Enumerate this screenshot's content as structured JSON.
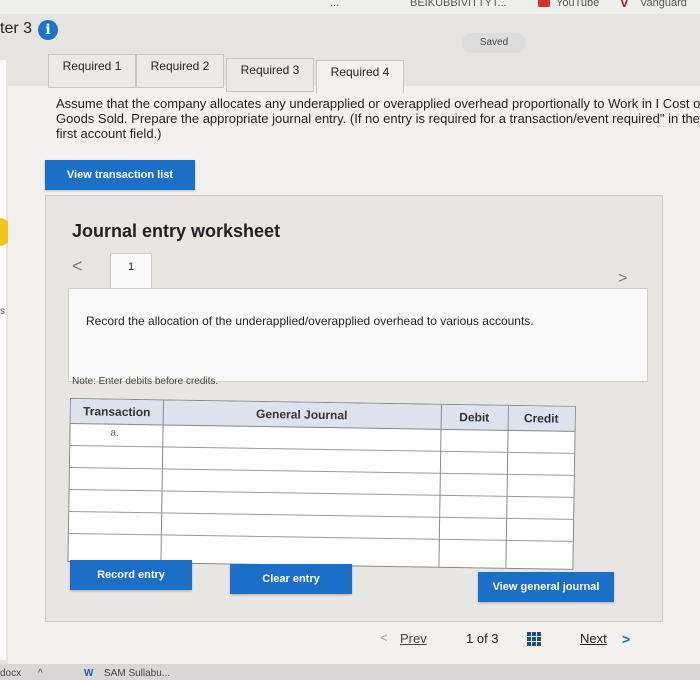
{
  "topbar": {
    "links": [
      "...",
      "BEIKUBBIVITTYT...",
      "YouTube",
      "Vanguard"
    ]
  },
  "chapter": {
    "label": "ter 3"
  },
  "saved": "Saved",
  "tabs": [
    {
      "label": "Required 1"
    },
    {
      "label": "Required 2"
    },
    {
      "label": "Required 3"
    },
    {
      "label": "Required 4"
    }
  ],
  "instructions": "Assume that the company allocates any underapplied or overapplied overhead proportionally to Work in I Cost of Goods Sold. Prepare the appropriate journal entry. (If no entry is required for a transaction/event required\" in the first account field.)",
  "view_transaction_label": "View transaction list",
  "worksheet": {
    "title": "Journal entry worksheet",
    "entry_number": "1",
    "record_text": "Record the allocation of the underapplied/overapplied overhead to various accounts.",
    "note": "Note: Enter debits before credits.",
    "table": {
      "headers": [
        "Transaction",
        "General Journal",
        "Debit",
        "Credit"
      ],
      "first_transaction": "a."
    },
    "record_label": "Record entry",
    "clear_label": "Clear entry",
    "view_journal_label": "View general journal"
  },
  "pager": {
    "prev": "Prev",
    "count": "1 of 3",
    "next": "Next"
  },
  "taskbar": {
    "left": "docx",
    "file": "SAM Sullabu..."
  },
  "colors": {
    "button": "#1b6fc6",
    "info": "#1a73c9",
    "youtube": "#d9302a"
  }
}
